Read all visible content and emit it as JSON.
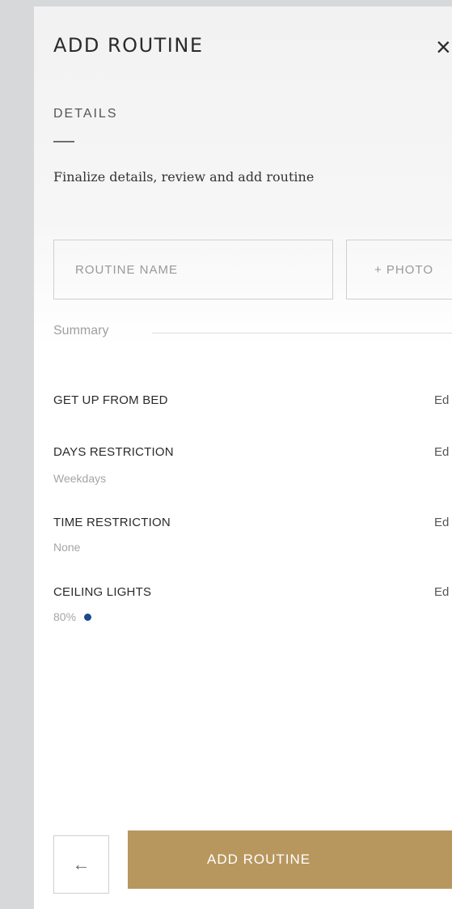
{
  "header": {
    "title": "ADD ROUTINE",
    "close_glyph": "×",
    "close_icon": "close-icon"
  },
  "details": {
    "section_label": "DETAILS",
    "subtitle": "Finalize details, review and add routine"
  },
  "form": {
    "routine_name_placeholder": "ROUTINE NAME",
    "routine_name_value": "",
    "photo_label": "+ PHOTO"
  },
  "summary": {
    "label": "Summary",
    "items": [
      {
        "title": "GET UP FROM BED",
        "value": "",
        "edit": "Ed"
      },
      {
        "title": "DAYS RESTRICTION",
        "value": "Weekdays",
        "edit": "Ed"
      },
      {
        "title": "TIME RESTRICTION",
        "value": "None",
        "edit": "Ed"
      },
      {
        "title": "CEILING LIGHTS",
        "value": "80%",
        "edit": "Ed",
        "indicator_color": "#1b4b8a"
      }
    ]
  },
  "footer": {
    "back_glyph": "←",
    "back_icon": "arrow-left-icon",
    "add_label": "ADD ROUTINE"
  },
  "colors": {
    "accent": "#b8975f",
    "background": "#d7d8d9",
    "light_indicator": "#1b4b8a"
  }
}
